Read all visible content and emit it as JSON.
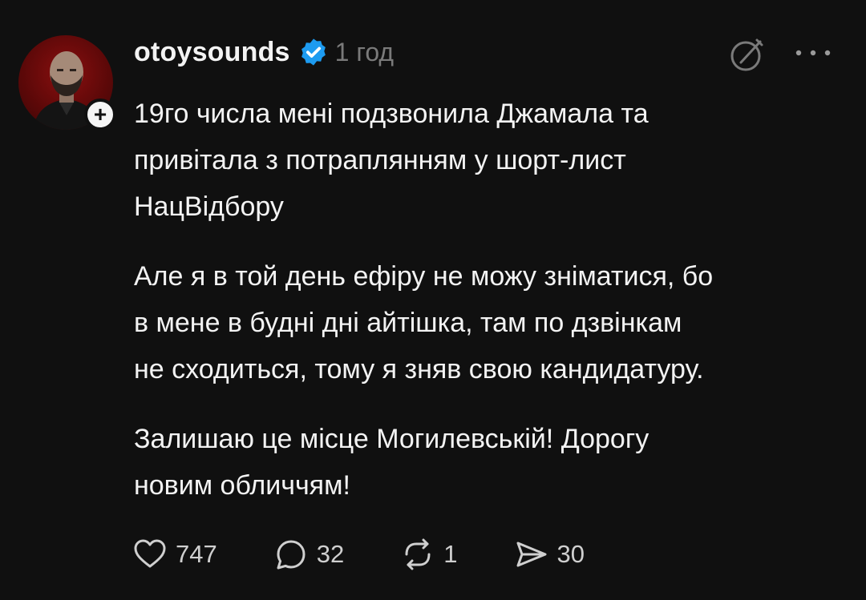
{
  "post": {
    "username": "otoysounds",
    "time": "1 год",
    "paragraphs": [
      "19го числа мені подзвонила Джамала та\nпривітала з потраплянням у шорт-лист\nНацВідбору",
      "Але я в той день ефіру не можу зніматися, бо\nв мене в будні дні айтішка, там по дзвінкам\nне сходиться, тому я зняв свою кандидатуру.",
      "Залишаю це місце Могилевській! Дорогу\nновим обличчям!"
    ],
    "follow_badge": "+",
    "actions": {
      "likes": "747",
      "comments": "32",
      "reposts": "1",
      "shares": "30"
    }
  },
  "icons": [
    "verified-badge-icon",
    "edit-icon",
    "more-icon",
    "heart-icon",
    "comment-icon",
    "repost-icon",
    "share-icon"
  ],
  "colors": {
    "background": "#101010",
    "text": "#f3f3f3",
    "muted": "#7a7a7a",
    "verified": "#1d9bf0",
    "avatar": "#7a0c0c"
  }
}
